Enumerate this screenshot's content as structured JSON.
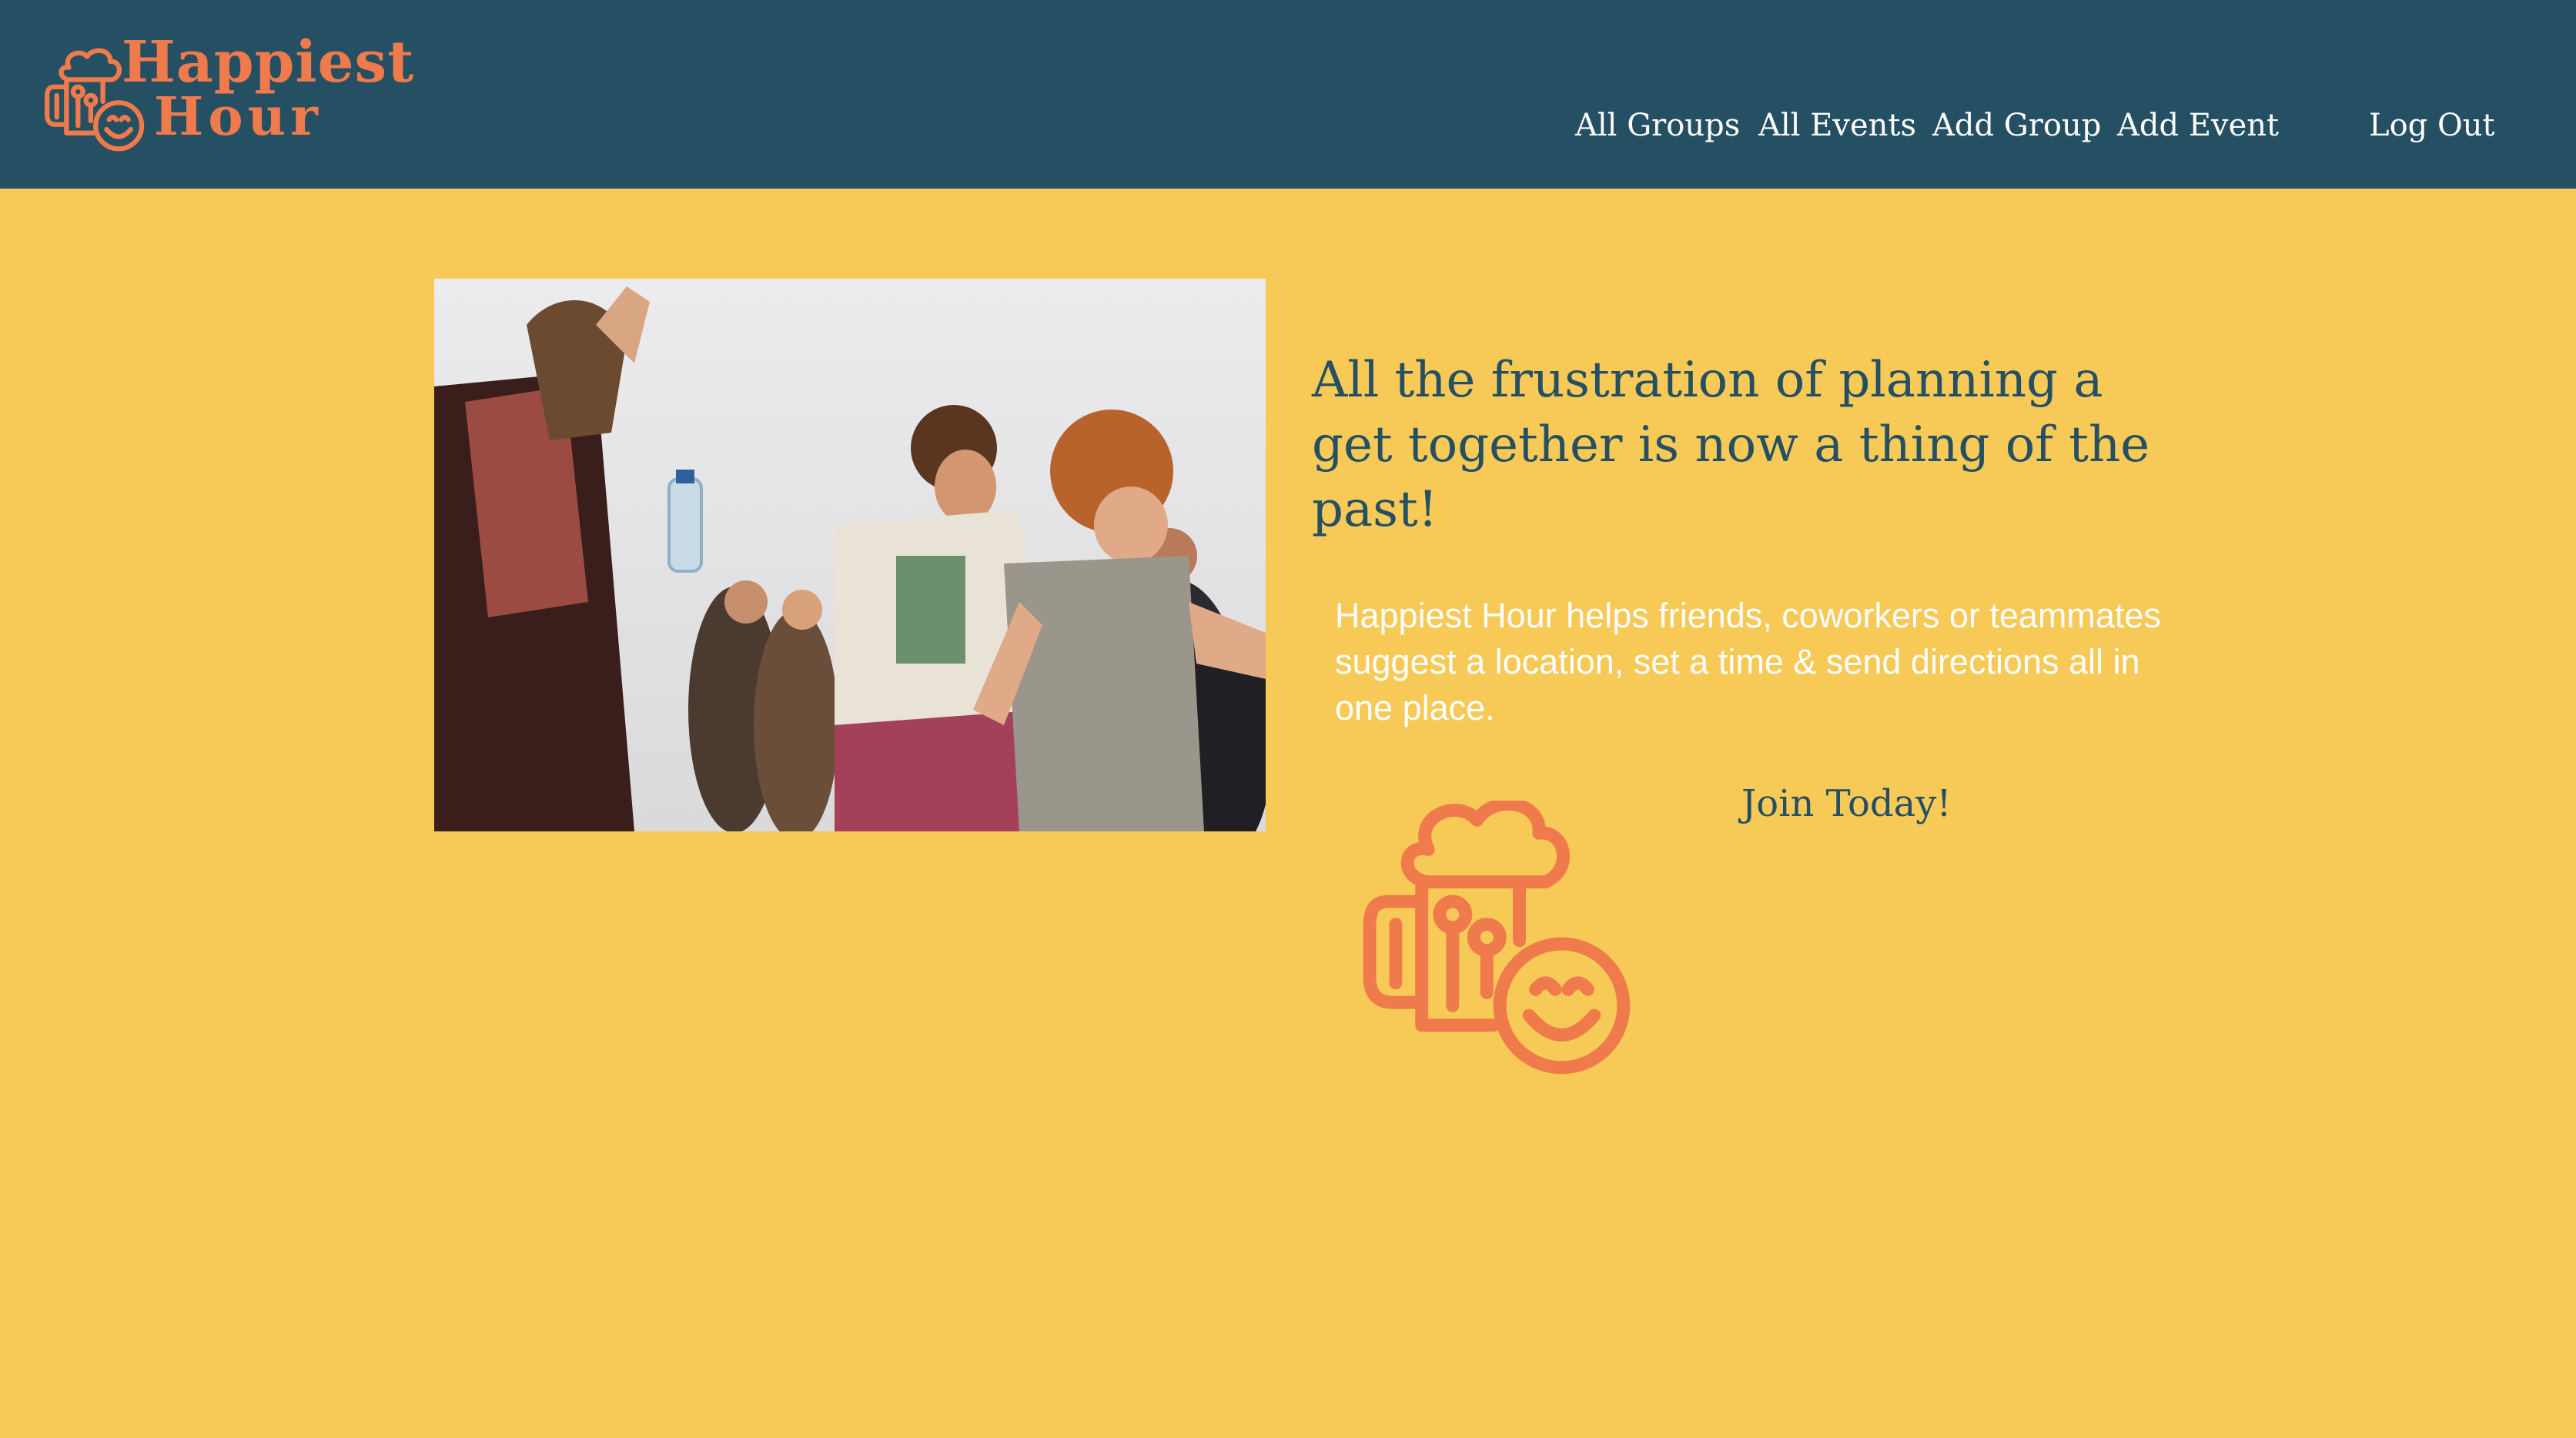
{
  "brand": {
    "line1": "Happiest",
    "line2": "Hour",
    "logo_icon": "beer-mug-smiley-icon",
    "accent_color": "#EF7A4C"
  },
  "colors": {
    "header_bg": "#255063",
    "page_bg": "#F7C957",
    "headline": "#255063",
    "description": "#FFFFFF"
  },
  "nav": {
    "all_groups": "All Groups",
    "all_events": "All Events",
    "add_group": "Add Group",
    "add_event": "Add Event",
    "log_out": "Log Out"
  },
  "hero": {
    "headline": "All the frustration of planning a get together is now a thing of the past!",
    "description": "Happiest Hour helps friends, coworkers or teammates suggest a location, set a time & send directions all in one place.",
    "cta": "Join Today!",
    "image_subject": "crowd-dancing-photo",
    "illustration_icon": "beer-mug-smiley-icon"
  }
}
